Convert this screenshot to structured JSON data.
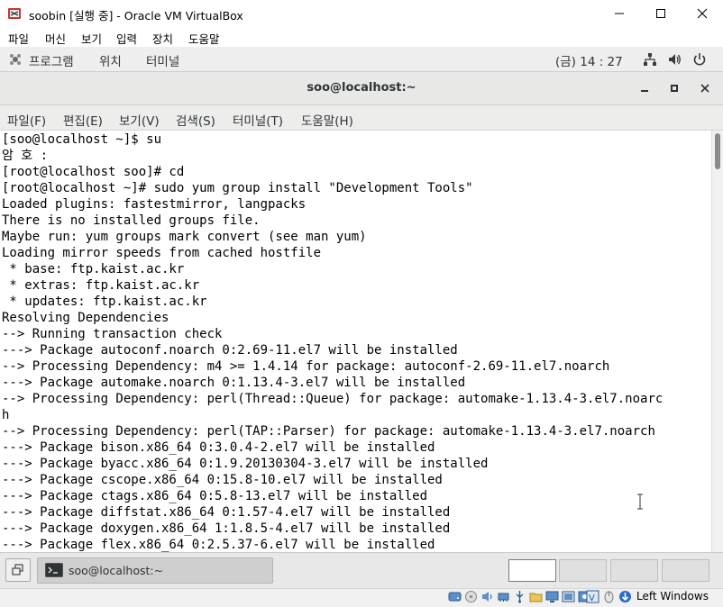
{
  "host_window": {
    "title": "soobin [실행 중] - Oracle VM VirtualBox",
    "menu": [
      "파일",
      "머신",
      "보기",
      "입력",
      "장치",
      "도움말"
    ]
  },
  "gnome_bar": {
    "apps": "프로그램",
    "places": "위치",
    "terminal": "터미널",
    "clock": "(금) 14 : 27"
  },
  "terminal": {
    "title": "soo@localhost:~",
    "menu": [
      "파일(F)",
      "편집(E)",
      "보기(V)",
      "검색(S)",
      "터미널(T)",
      "도움말(H)"
    ],
    "lines": [
      "[soo@localhost ~]$ su",
      "암 호 :",
      "[root@localhost soo]# cd",
      "[root@localhost ~]# sudo yum group install \"Development Tools\"",
      "Loaded plugins: fastestmirror, langpacks",
      "There is no installed groups file.",
      "Maybe run: yum groups mark convert (see man yum)",
      "Loading mirror speeds from cached hostfile",
      " * base: ftp.kaist.ac.kr",
      " * extras: ftp.kaist.ac.kr",
      " * updates: ftp.kaist.ac.kr",
      "Resolving Dependencies",
      "--> Running transaction check",
      "---> Package autoconf.noarch 0:2.69-11.el7 will be installed",
      "--> Processing Dependency: m4 >= 1.4.14 for package: autoconf-2.69-11.el7.noarch",
      "---> Package automake.noarch 0:1.13.4-3.el7 will be installed",
      "--> Processing Dependency: perl(Thread::Queue) for package: automake-1.13.4-3.el7.noarc",
      "h",
      "--> Processing Dependency: perl(TAP::Parser) for package: automake-1.13.4-3.el7.noarch",
      "---> Package bison.x86_64 0:3.0.4-2.el7 will be installed",
      "---> Package byacc.x86_64 0:1.9.20130304-3.el7 will be installed",
      "---> Package cscope.x86_64 0:15.8-10.el7 will be installed",
      "---> Package ctags.x86_64 0:5.8-13.el7 will be installed",
      "---> Package diffstat.x86_64 0:1.57-4.el7 will be installed",
      "---> Package doxygen.x86_64 1:1.8.5-4.el7 will be installed",
      "---> Package flex.x86_64 0:2.5.37-6.el7 will be installed"
    ]
  },
  "taskbar": {
    "task_label": "soo@localhost:~"
  },
  "host_status": {
    "host_key": "Left Windows"
  },
  "colors": {
    "terminal_text": "#000000",
    "gnome_bar_bg": "#eeeeee",
    "host_status_bg": "#f0f0f0"
  }
}
